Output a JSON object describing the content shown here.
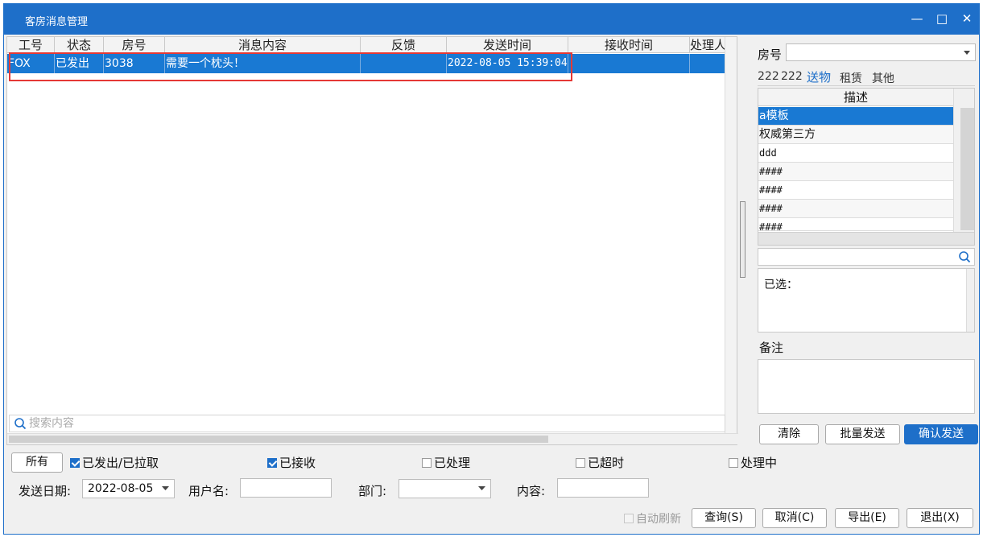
{
  "window": {
    "title": "客房消息管理",
    "controls": {
      "minimize": "—",
      "maximize": "□",
      "close": "✕"
    }
  },
  "grid": {
    "columns": [
      "工号",
      "状态",
      "房号",
      "消息内容",
      "反馈",
      "发送时间",
      "接收时间",
      "处理人"
    ],
    "rows": [
      {
        "staff": "FOX",
        "status": "已发出",
        "room": "3038",
        "content": "需要一个枕头！",
        "feedback": "",
        "send_time": "2022-08-05 15:39:04",
        "recv_time": "",
        "handler": ""
      }
    ],
    "search_placeholder": "搜索内容"
  },
  "right_panel": {
    "room_label": "房号",
    "room_value": "",
    "tabs": [
      "222",
      "222",
      "送物",
      "租赁",
      "其他"
    ],
    "active_tab": "送物",
    "desc_header": "描述",
    "desc_items": [
      "a模板",
      "权威第三方",
      "ddd",
      "####",
      "####",
      "####",
      "####"
    ],
    "chosen_label": "已选：",
    "note_label": "备注",
    "buttons": {
      "clear": "清除",
      "batch_send": "批量发送",
      "confirm_send": "确认发送"
    }
  },
  "filters": {
    "all_button": "所有",
    "checks": [
      {
        "label": "已发出/已拉取",
        "checked": true
      },
      {
        "label": "已接收",
        "checked": true
      },
      {
        "label": "已处理",
        "checked": false
      },
      {
        "label": "已超时",
        "checked": false
      },
      {
        "label": "处理中",
        "checked": false
      }
    ],
    "date_label": "发送日期:",
    "date_value": "2022-08-05",
    "user_label": "用户名:",
    "dept_label": "部门:",
    "content_label": "内容:",
    "auto_refresh": "自动刷新",
    "buttons": {
      "query": "查询(S)",
      "cancel": "取消(C)",
      "export": "导出(E)",
      "exit": "退出(X)"
    }
  },
  "colors": {
    "accent": "#1e6fc9",
    "selection": "#1979d3",
    "highlight_box": "#e53935"
  }
}
